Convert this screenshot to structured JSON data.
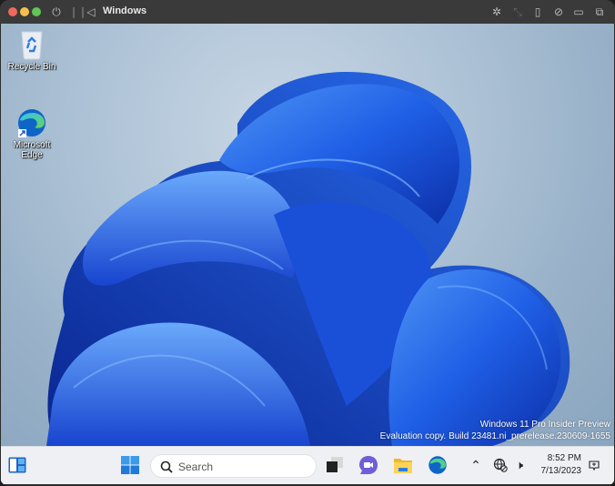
{
  "window": {
    "title": "Windows",
    "toolbar_icons": [
      "power-icon",
      "pause-icon",
      "back-icon",
      "brightness-icon",
      "resize-icon",
      "usb-icon",
      "share-icon",
      "folder-icon",
      "windows-icon"
    ]
  },
  "desktop": {
    "icons": [
      {
        "label": "Recycle Bin",
        "icon": "recycle-bin-icon"
      },
      {
        "label_line1": "Microsoft",
        "label_line2": "Edge",
        "icon": "edge-icon"
      }
    ],
    "watermark": {
      "line1": "Windows 11 Pro Insider Preview",
      "line2": "Evaluation copy. Build 23481.ni_prerelease.230609-1655"
    }
  },
  "taskbar": {
    "search_placeholder": "Search",
    "apps": [
      "widgets",
      "start",
      "task-view",
      "teams-chat",
      "file-explorer",
      "edge"
    ],
    "tray": {
      "time": "8:52 PM",
      "date": "7/13/2023"
    }
  }
}
